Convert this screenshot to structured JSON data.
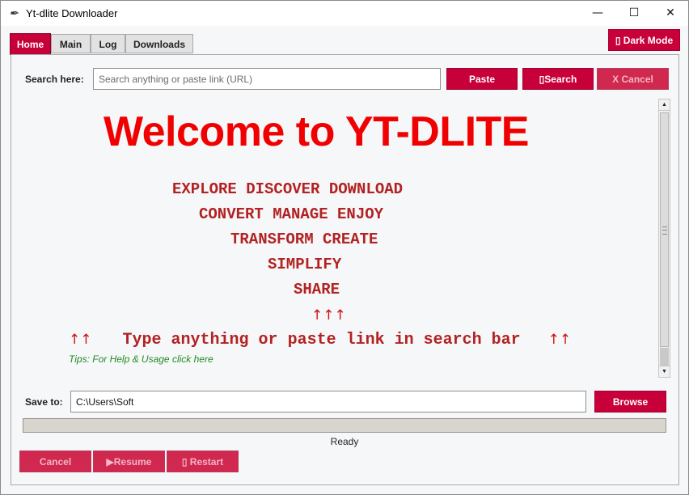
{
  "window": {
    "title": "Yt-dlite Downloader",
    "icon": "feather-icon",
    "minimize_glyph": "—",
    "maximize_glyph": "☐",
    "close_glyph": "✕"
  },
  "tabs": [
    {
      "label": "Home",
      "active": true
    },
    {
      "label": "Main",
      "active": false
    },
    {
      "label": "Log",
      "active": false
    },
    {
      "label": "Downloads",
      "active": false
    }
  ],
  "dark_mode_label": "▯ Dark Mode",
  "search": {
    "label": "Search here:",
    "placeholder": "Search anything or paste link (URL)",
    "value": "",
    "paste_label": "Paste",
    "search_label": "▯Search",
    "cancel_label": "X Cancel"
  },
  "content": {
    "welcome": "Welcome to YT-DLITE",
    "lines": [
      "EXPLORE   DISCOVER   DOWNLOAD",
      "CONVERT   MANAGE   ENJOY",
      "TRANSFORM   CREATE",
      "SIMPLIFY",
      "SHARE"
    ],
    "arrows_top": "↑↑↑",
    "arrow_left": "↑↑",
    "instruction": "Type anything or paste link in search bar",
    "arrow_right": "↑↑",
    "tips": "Tips: For Help & Usage click here"
  },
  "save": {
    "label": "Save to:",
    "path": "C:\\Users\\Soft",
    "browse_label": "Browse"
  },
  "progress": {
    "value": 0
  },
  "status": "Ready",
  "controls": {
    "cancel_label": "Cancel",
    "resume_label": "▶Resume",
    "restart_label": "▯ Restart"
  },
  "colors": {
    "accent": "#c8003a",
    "welcome": "#f00000",
    "words": "#b22222",
    "tips": "#228b22"
  }
}
